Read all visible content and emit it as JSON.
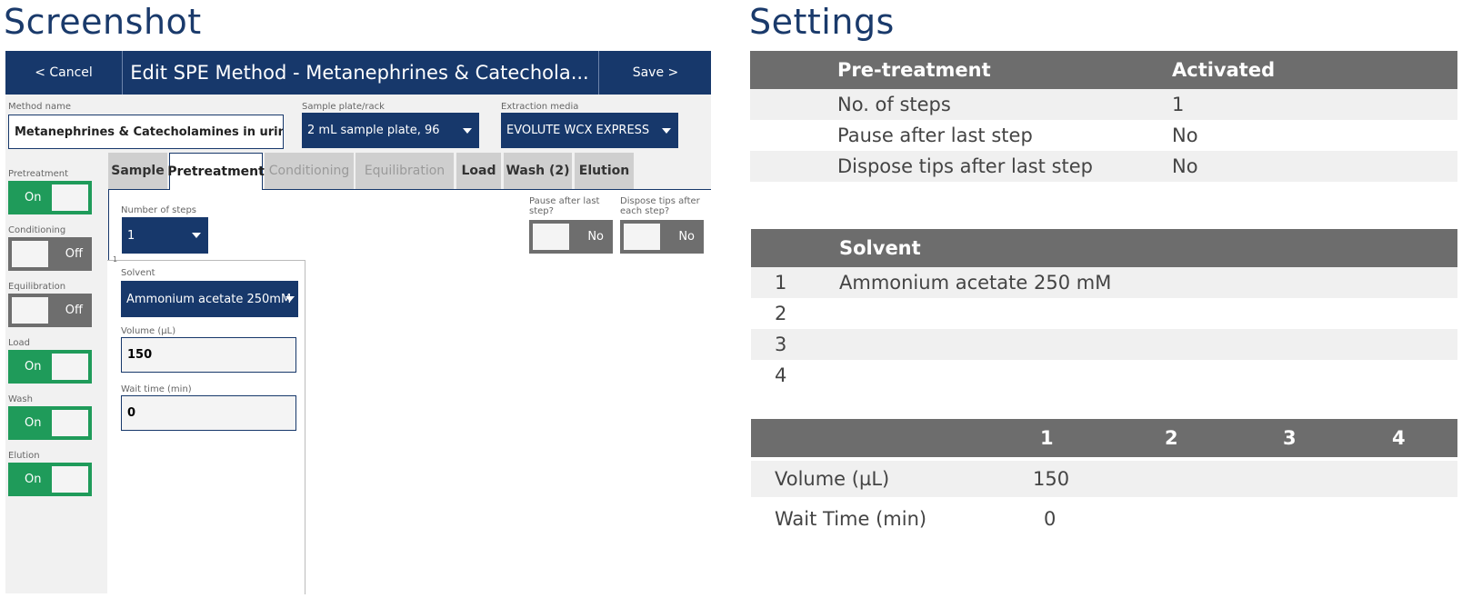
{
  "headings": {
    "screenshot": "Screenshot",
    "settings": "Settings"
  },
  "app": {
    "cancel_label": "< Cancel",
    "title": "Edit SPE Method - Metanephrines & Catechola...",
    "save_label": "Save >"
  },
  "fields": {
    "method_name_label": "Method name",
    "method_name_value": "Metanephrines & Catecholamines in urine",
    "sample_plate_label": "Sample plate/rack",
    "sample_plate_value": "2 mL sample plate, 96",
    "extraction_media_label": "Extraction media",
    "extraction_media_value": "EVOLUTE WCX EXPRESS"
  },
  "toggles": [
    {
      "label": "Pretreatment",
      "state": "On"
    },
    {
      "label": "Conditioning",
      "state": "Off"
    },
    {
      "label": "Equilibration",
      "state": "Off"
    },
    {
      "label": "Load",
      "state": "On"
    },
    {
      "label": "Wash",
      "state": "On"
    },
    {
      "label": "Elution",
      "state": "On"
    }
  ],
  "tabs": [
    {
      "label": "Sample",
      "state": "normal"
    },
    {
      "label": "Pretreatment",
      "state": "active"
    },
    {
      "label": "Conditioning",
      "state": "disabled"
    },
    {
      "label": "Equilibration",
      "state": "disabled"
    },
    {
      "label": "Load",
      "state": "normal"
    },
    {
      "label": "Wash (2)",
      "state": "normal"
    },
    {
      "label": "Elution",
      "state": "normal"
    }
  ],
  "pretreatment_tab": {
    "steps_label": "Number of steps",
    "steps_value": "1",
    "pause_label": "Pause after last step?",
    "pause_value": "No",
    "dispose_label": "Dispose tips after each step?",
    "dispose_value": "No",
    "step_marker": "1",
    "solvent_label": "Solvent",
    "solvent_value": "Ammonium acetate 250mM",
    "volume_label": "Volume (µL)",
    "volume_value": "150",
    "wait_label": "Wait time (min)",
    "wait_value": "0"
  },
  "settings_pretreatment": {
    "header": [
      "Pre-treatment",
      "Activated"
    ],
    "rows": [
      [
        "No. of steps",
        "1"
      ],
      [
        "Pause after last step",
        "No"
      ],
      [
        "Dispose tips after last step",
        "No"
      ]
    ]
  },
  "settings_solvent": {
    "header": "Solvent",
    "rows": [
      [
        "1",
        "Ammonium acetate 250 mM"
      ],
      [
        "2",
        ""
      ],
      [
        "3",
        ""
      ],
      [
        "4",
        ""
      ]
    ]
  },
  "settings_steps": {
    "header": [
      "",
      "1",
      "2",
      "3",
      "4"
    ],
    "rows": [
      [
        "Volume (µL)",
        "150",
        "",
        "",
        ""
      ],
      [
        "Wait Time (min)",
        "0",
        "",
        "",
        ""
      ]
    ]
  },
  "colors": {
    "navy": "#17386b",
    "toggle_on": "#1f9b5a",
    "toggle_off": "#6e6e6e",
    "table_header": "#6d6d6d",
    "row_shade": "#f0f0f0"
  }
}
